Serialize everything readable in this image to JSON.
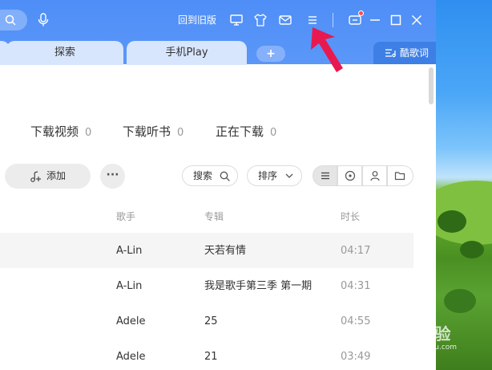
{
  "header": {
    "old_version_label": "回到旧版"
  },
  "tabs": [
    {
      "label": "探索"
    },
    {
      "label": "手机Play"
    }
  ],
  "tab_add_label": "+",
  "lyrics_button_label": "酷歌词",
  "categories": [
    {
      "label": "下载视频",
      "count": "0"
    },
    {
      "label": "下载听书",
      "count": "0"
    },
    {
      "label": "正在下载",
      "count": "0"
    }
  ],
  "toolbar": {
    "add_label": "添加",
    "more_label": "···",
    "search_label": "搜索",
    "sort_label": "排序"
  },
  "columns": {
    "artist": "歌手",
    "album": "专辑",
    "duration": "时长"
  },
  "songs": [
    {
      "artist": "A-Lin",
      "album": "天若有情",
      "duration": "04:17"
    },
    {
      "artist": "A-Lin",
      "album": "我是歌手第三季 第一期",
      "duration": "04:31"
    },
    {
      "artist": "Adele",
      "album": "25",
      "duration": "04:55"
    },
    {
      "artist": "Adele",
      "album": "21",
      "duration": "03:49"
    }
  ],
  "watermark": {
    "text": "Bai 经验",
    "url": "jingyan.baidu.com"
  },
  "colors": {
    "titlebar": "#4f8ef7",
    "accent_arrow": "#e8194f",
    "row_highlight": "#f5f5f5"
  }
}
